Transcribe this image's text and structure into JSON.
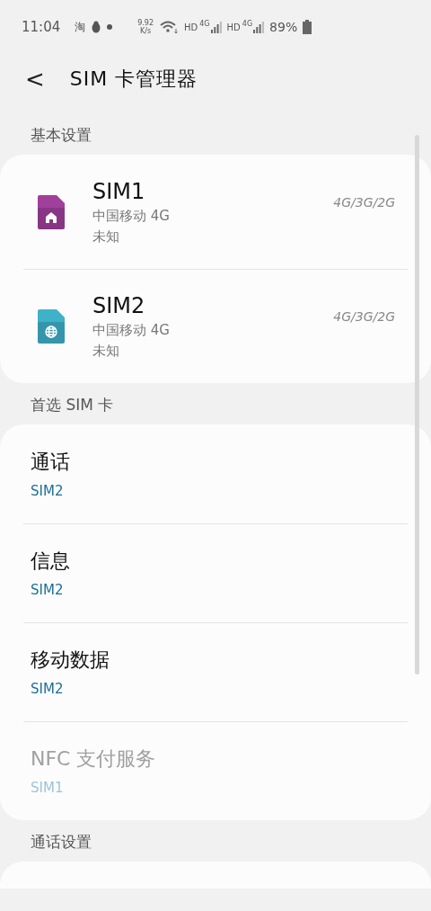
{
  "status_bar": {
    "time": "11:04",
    "app_glyph": "淘",
    "speed_value": "9.92",
    "speed_unit": "K/s",
    "networks": [
      {
        "hd": "HD",
        "type": "4G"
      },
      {
        "hd": "HD",
        "type": "4G"
      }
    ],
    "battery": "89%"
  },
  "header": {
    "back": "<",
    "title": "SIM 卡管理器"
  },
  "sections": [
    {
      "title": "基本设置",
      "kind": "sims",
      "items": [
        {
          "name": "SIM1",
          "carrier": "中国移动 4G",
          "status": "未知",
          "network": "4G/3G/2G",
          "color": "#a0409a",
          "kind": "home"
        },
        {
          "name": "SIM2",
          "carrier": "中国移动 4G",
          "status": "未知",
          "network": "4G/3G/2G",
          "color": "#3fb1c9",
          "kind": "globe"
        }
      ]
    },
    {
      "title": "首选 SIM 卡",
      "kind": "prefs",
      "items": [
        {
          "label": "通话",
          "value": "SIM2",
          "disabled": false
        },
        {
          "label": "信息",
          "value": "SIM2",
          "disabled": false
        },
        {
          "label": "移动数据",
          "value": "SIM2",
          "disabled": false
        },
        {
          "label": "NFC 支付服务",
          "value": "SIM1",
          "disabled": true
        }
      ]
    },
    {
      "title": "通话设置",
      "kind": "prefs"
    }
  ]
}
